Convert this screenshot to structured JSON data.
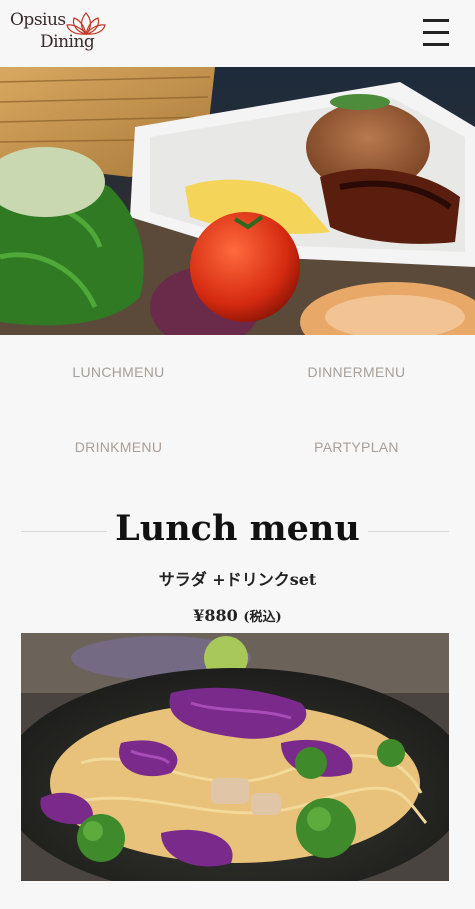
{
  "header": {
    "logo_line1": "Opsius",
    "logo_line2": "Dining",
    "menu_icon": "hamburger-icon"
  },
  "hero": {
    "image": "thai-fried-rice-photo"
  },
  "nav": {
    "lunch": "LUNCHMENU",
    "dinner": "DINNERMENU",
    "drink": "DRINKMENU",
    "party": "PARTYPLAN"
  },
  "lunch": {
    "title": "Lunch menu",
    "subtitle": "サラダ +ドリンクset",
    "price": "¥880",
    "tax": "(税込)",
    "image": "pad-thai-cabbage-photo"
  }
}
